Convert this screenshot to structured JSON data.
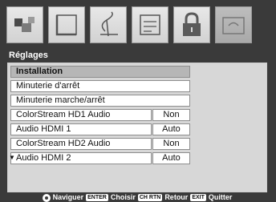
{
  "icons": [
    {
      "name": "picture-icon"
    },
    {
      "name": "display-icon"
    },
    {
      "name": "audio-icon"
    },
    {
      "name": "preferences-icon"
    },
    {
      "name": "lock-icon"
    },
    {
      "name": "setup-icon",
      "selected": true
    }
  ],
  "menu": {
    "title": "Réglages",
    "rows": [
      {
        "label": "Installation",
        "selected": true
      },
      {
        "label": "Minuterie d'arrêt"
      },
      {
        "label": "Minuterie marche/arrêt"
      },
      {
        "label": "ColorStream HD1 Audio",
        "value": "Non"
      },
      {
        "label": "Audio HDMI 1",
        "value": "Auto"
      },
      {
        "label": "ColorStream HD2 Audio",
        "value": "Non"
      },
      {
        "label": "Audio HDMI 2",
        "value": "Auto"
      }
    ]
  },
  "footer": {
    "navigate": "Naviguer",
    "enter_key": "ENTER",
    "choose": "Choisir",
    "ch_rtn_key": "CH RTN",
    "back": "Retour",
    "exit_key": "EXIT",
    "quit": "Quitter"
  }
}
